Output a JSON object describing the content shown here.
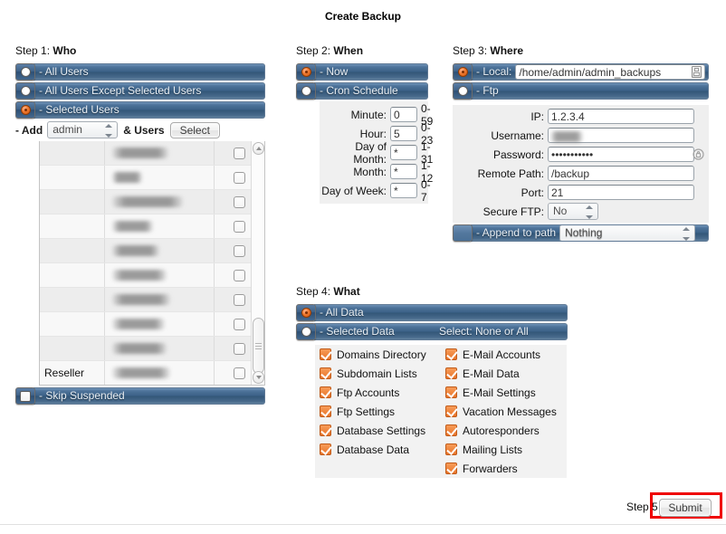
{
  "page": {
    "title": "Create Backup"
  },
  "step1": {
    "heading_prefix": "Step 1: ",
    "heading": "Who",
    "options": [
      {
        "label": "- All Users",
        "selected": false
      },
      {
        "label": "- All Users Except Selected Users",
        "selected": false
      },
      {
        "label": "- Selected Users",
        "selected": true
      }
    ],
    "add_label": "- Add",
    "add_value": "admin",
    "users_label": "& Users",
    "select_button": "Select",
    "user_rows": [
      {
        "type": "",
        "name_redacted": true,
        "name_width": 62,
        "checked": false
      },
      {
        "type": "",
        "name_redacted": true,
        "name_width": 33,
        "checked": false
      },
      {
        "type": "",
        "name_redacted": true,
        "name_width": 78,
        "checked": false
      },
      {
        "type": "",
        "name_redacted": true,
        "name_width": 45,
        "checked": false
      },
      {
        "type": "",
        "name_redacted": true,
        "name_width": 52,
        "checked": false
      },
      {
        "type": "",
        "name_redacted": true,
        "name_width": 60,
        "checked": false
      },
      {
        "type": "",
        "name_redacted": true,
        "name_width": 64,
        "checked": false
      },
      {
        "type": "",
        "name_redacted": true,
        "name_width": 58,
        "checked": false
      },
      {
        "type": "",
        "name_redacted": true,
        "name_width": 60,
        "checked": false
      },
      {
        "type": "Reseller",
        "name_redacted": true,
        "name_width": 64,
        "checked": false
      }
    ],
    "skip_suspended": {
      "label": "- Skip Suspended",
      "checked": false
    }
  },
  "step2": {
    "heading_prefix": "Step 2: ",
    "heading": "When",
    "options": [
      {
        "label": "- Now",
        "selected": true
      },
      {
        "label": "- Cron Schedule",
        "selected": false
      }
    ],
    "cron": [
      {
        "label": "Minute:",
        "value": "0",
        "range": "0-59"
      },
      {
        "label": "Hour:",
        "value": "5",
        "range": "0-23"
      },
      {
        "label": "Day of Month:",
        "value": "*",
        "range": "1-31"
      },
      {
        "label": "Month:",
        "value": "*",
        "range": "1-12"
      },
      {
        "label": "Day of Week:",
        "value": "*",
        "range": "0-7"
      }
    ]
  },
  "step3": {
    "heading_prefix": "Step 3: ",
    "heading": "Where",
    "local": {
      "label": "- Local:",
      "selected": true,
      "path": "/home/admin/admin_backups"
    },
    "ftp": {
      "label": "- Ftp",
      "selected": false,
      "fields": [
        {
          "label": "IP:",
          "value": "1.2.3.4",
          "redacted": false,
          "password": false
        },
        {
          "label": "Username:",
          "value": "",
          "redacted": true,
          "password": false
        },
        {
          "label": "Password:",
          "value": "•••••••••••",
          "redacted": false,
          "password": true
        },
        {
          "label": "Remote Path:",
          "value": "/backup",
          "redacted": false,
          "password": false
        },
        {
          "label": "Port:",
          "value": "21",
          "redacted": false,
          "password": false
        }
      ],
      "secure_ftp_label": "Secure FTP:",
      "secure_ftp_value": "No"
    },
    "append": {
      "label": "- Append to path",
      "value": "Nothing"
    }
  },
  "step4": {
    "heading_prefix": "Step 4: ",
    "heading": "What",
    "options": [
      {
        "label": "- All Data",
        "selected": true,
        "inset": ""
      },
      {
        "label": "- Selected Data",
        "selected": false,
        "inset": "Select: None or All"
      }
    ],
    "column_left": [
      {
        "label": "Domains Directory",
        "checked": true
      },
      {
        "label": "Subdomain Lists",
        "checked": true
      },
      {
        "label": "Ftp Accounts",
        "checked": true
      },
      {
        "label": "Ftp Settings",
        "checked": true
      },
      {
        "label": "Database Settings",
        "checked": true
      },
      {
        "label": "Database Data",
        "checked": true
      }
    ],
    "column_right": [
      {
        "label": "E-Mail Accounts",
        "checked": true
      },
      {
        "label": "E-Mail Data",
        "checked": true
      },
      {
        "label": "E-Mail Settings",
        "checked": true
      },
      {
        "label": "Vacation Messages",
        "checked": true
      },
      {
        "label": "Autoresponders",
        "checked": true
      },
      {
        "label": "Mailing Lists",
        "checked": true
      },
      {
        "label": "Forwarders",
        "checked": true
      }
    ]
  },
  "step5": {
    "label": "Step 5",
    "submit_button": "Submit",
    "highlight_color": "#ef0000"
  },
  "colors": {
    "bar_blue": "#3c6287",
    "accent_orange": "#e8742a",
    "highlight_red": "#ef0000"
  }
}
